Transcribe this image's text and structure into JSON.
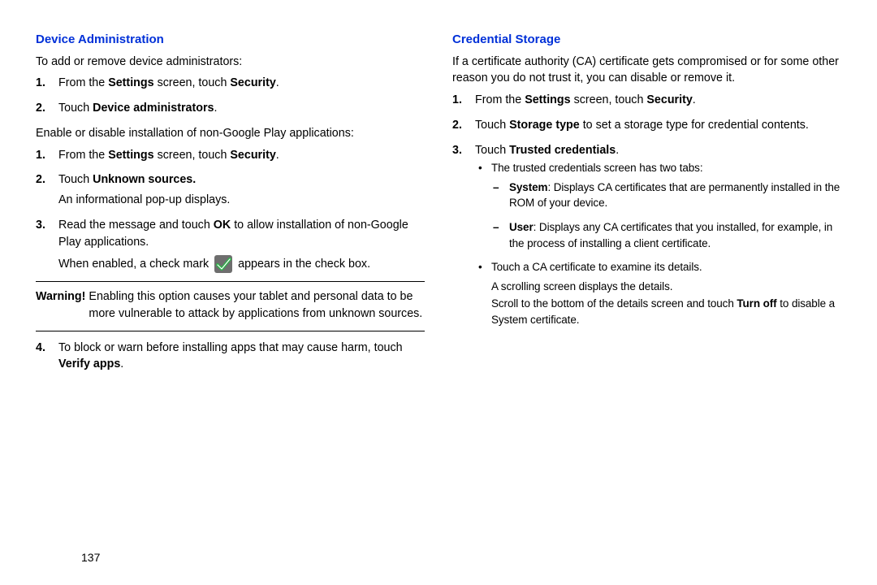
{
  "pageNumber": "137",
  "left": {
    "title": "Device Administration",
    "intro1": "To add or remove device administrators:",
    "list1": {
      "i1_num": "1.",
      "i1_a": "From the ",
      "i1_b": "Settings",
      "i1_c": " screen, touch ",
      "i1_d": "Security",
      "i1_e": ".",
      "i2_num": "2.",
      "i2_a": "Touch ",
      "i2_b": "Device administrators",
      "i2_c": "."
    },
    "intro2": "Enable or disable installation of non-Google Play applications:",
    "list2": {
      "i1_num": "1.",
      "i1_a": "From the ",
      "i1_b": "Settings",
      "i1_c": " screen, touch ",
      "i1_d": "Security",
      "i1_e": ".",
      "i2_num": "2.",
      "i2_a": "Touch ",
      "i2_b": "Unknown sources.",
      "i2_extra": "An informational pop-up displays.",
      "i3_num": "3.",
      "i3_a": "Read the message and touch ",
      "i3_b": "OK",
      "i3_c": " to allow installation of non-Google Play applications.",
      "i3_extra_a": "When enabled, a check mark ",
      "i3_extra_b": " appears in the check box.",
      "i4_num": "4.",
      "i4_a": "To block or warn before installing apps that may cause harm, touch ",
      "i4_b": "Verify apps",
      "i4_c": "."
    },
    "warning_label": "Warning!",
    "warning_text": "Enabling this option causes your tablet and personal data to be more vulnerable to attack by applications from unknown sources."
  },
  "right": {
    "title": "Credential Storage",
    "intro": "If a certificate authority (CA) certificate gets compromised or for some other reason you do not trust it, you can disable or remove it.",
    "list": {
      "i1_num": "1.",
      "i1_a": "From the ",
      "i1_b": "Settings",
      "i1_c": " screen, touch ",
      "i1_d": "Security",
      "i1_e": ".",
      "i2_num": "2.",
      "i2_a": "Touch ",
      "i2_b": "Storage type",
      "i2_c": " to set a storage type for credential contents.",
      "i3_num": "3.",
      "i3_a": "Touch ",
      "i3_b": "Trusted credentials",
      "i3_c": "."
    },
    "b1": "The trusted credentials screen has two tabs:",
    "d1_a": "System",
    "d1_b": ": Displays CA certificates that are permanently installed in the ROM of your device.",
    "d2_a": "User",
    "d2_b": ": Displays any CA certificates that you installed, for example, in the process of installing a client certificate.",
    "b2": "Touch a CA certificate to examine its details.",
    "b2_extra1": "A scrolling screen displays the details.",
    "b2_extra2_a": "Scroll to the bottom of the details screen and touch ",
    "b2_extra2_b": "Turn off",
    "b2_extra2_c": " to disable a System certificate."
  }
}
